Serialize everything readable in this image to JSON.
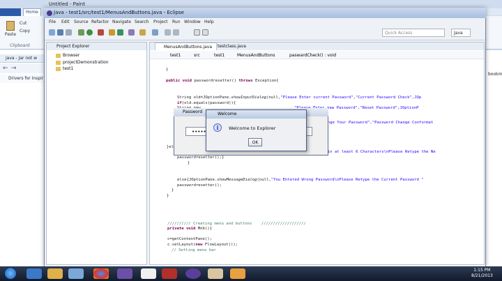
{
  "paint": {
    "title": "Untitled - Paint",
    "home_tab": "Home",
    "paste_label": "Paste",
    "cut_label": "Cut",
    "copy_label": "Copy",
    "clipboard_label": "Clipboard"
  },
  "browser": {
    "tab_label": "java - Jar not w",
    "favorites_item": "Drivers for Inspir"
  },
  "right_strip_text": "bookma",
  "eclipse": {
    "title": "Java - test1/src/test1/MenusAndButtons.java - Eclipse",
    "menu": [
      "File",
      "Edit",
      "Source",
      "Refactor",
      "Navigate",
      "Search",
      "Project",
      "Run",
      "Window",
      "Help"
    ],
    "quick_access_placeholder": "Quick Access",
    "perspective": "Java",
    "project_explorer": {
      "tab": "Project Explorer",
      "items": [
        "Browser",
        "projectDemonstration",
        "test1"
      ]
    },
    "editor_tabs": [
      "MenusAndButtons.java",
      "testclass.java"
    ],
    "breadcrumb": [
      "test1",
      "src",
      "test1",
      "MenusAndButtons",
      "paswardCheck() : void"
    ],
    "code": {
      "l1": "}",
      "l2_kw1": "public void ",
      "l2_rest": "passwordresetter() ",
      "l2_kw2": "throws ",
      "l2_end": "Exception{",
      "l3a": "String old=JOptionPane.",
      "l3b": "showInputDialog",
      "l3c": "(null,",
      "l3d": "\"Please Enter current Password\",\"Current Password Check\",JOp",
      "l4a": "if",
      "l4b": "(old.equals(password)){",
      "l5a": "String new",
      "l5b": "\"Please Enter new Password\",\"Reset Password\",JOptionP",
      "l6": "hange Your Password\",\"Password Change Conformat",
      "l7a": "}el",
      "l7b": "tain at least 6 Characters\\nPlease Retype the Ne",
      "l8": "passwordresetter();}",
      "l9": "}",
      "l10a": "else{JOptionPane.",
      "l10b": "showMessageDialog",
      "l10c": "(null,",
      "l10d": "\"You Entered Wrong Password\\nPlease Retype the Current Password \"",
      "l11": "passwordresetter();",
      "l12": "}",
      "l13": "}",
      "l14": "////////// Creating menu and buttons    ///////////////////",
      "l15_kw": "private void ",
      "l15_rest": "Mnb(){",
      "l16": "c=getContentPane();",
      "l17a": "c.setLayout(",
      "l17b": "new ",
      "l17c": "FlowLayout());",
      "l18": "// Setting menu bar"
    }
  },
  "password_dialog": {
    "title": "Password",
    "field_value": "••••••"
  },
  "welcome_dialog": {
    "title": "Welcome",
    "message": "Welcome to Explorer",
    "ok_label": "OK",
    "icon": "info-icon"
  },
  "taskbar": {
    "time": "1:15 PM",
    "date": "8/21/2013"
  }
}
